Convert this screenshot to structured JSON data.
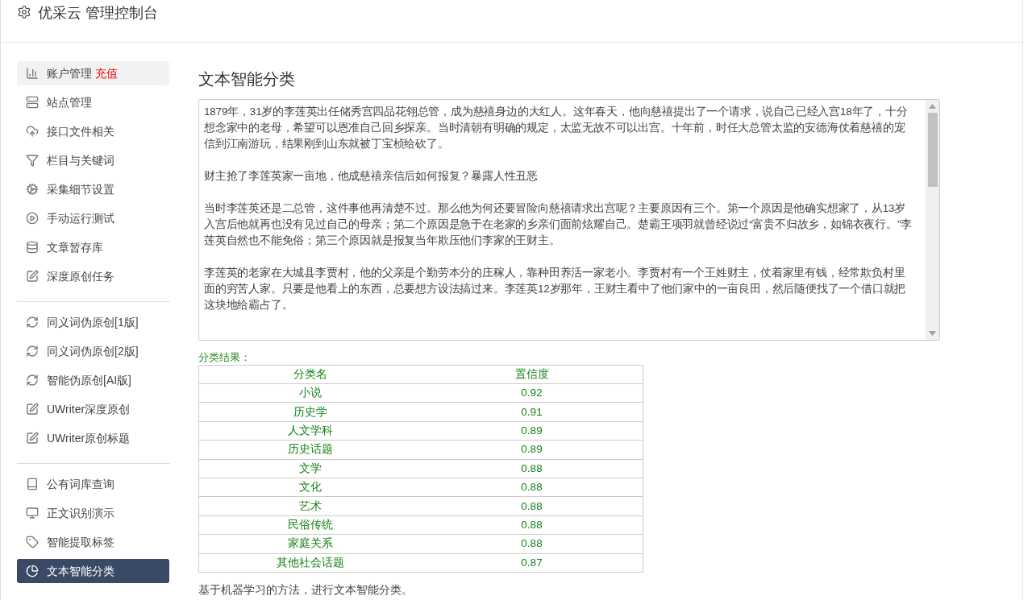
{
  "header": {
    "title": "优采云 管理控制台"
  },
  "sidebar": {
    "groups": [
      [
        {
          "label": "账户管理",
          "badge": "充值",
          "kind": "chart",
          "selected": false,
          "highlighted": true
        },
        {
          "label": "站点管理",
          "kind": "server",
          "selected": false,
          "highlighted": false
        },
        {
          "label": "接口文件相关",
          "kind": "cloud",
          "selected": false,
          "highlighted": false
        },
        {
          "label": "栏目与关键词",
          "kind": "filter",
          "selected": false,
          "highlighted": false
        },
        {
          "label": "采集细节设置",
          "kind": "cogs",
          "selected": false,
          "highlighted": false
        },
        {
          "label": "手动运行测试",
          "kind": "play",
          "selected": false,
          "highlighted": false
        },
        {
          "label": "文章暂存库",
          "kind": "database",
          "selected": false,
          "highlighted": false
        },
        {
          "label": "深度原创任务",
          "kind": "edit",
          "selected": false,
          "highlighted": false
        }
      ],
      [
        {
          "label": "同义词伪原创[1版]",
          "kind": "refresh",
          "selected": false,
          "highlighted": false
        },
        {
          "label": "同义词伪原创[2版]",
          "kind": "refresh",
          "selected": false,
          "highlighted": false
        },
        {
          "label": "智能伪原创[AI版]",
          "kind": "refresh",
          "selected": false,
          "highlighted": false
        },
        {
          "label": "UWriter深度原创",
          "kind": "edit",
          "selected": false,
          "highlighted": false
        },
        {
          "label": "UWriter原创标题",
          "kind": "edit",
          "selected": false,
          "highlighted": false
        }
      ],
      [
        {
          "label": "公有词库查询",
          "kind": "book",
          "selected": false,
          "highlighted": false
        },
        {
          "label": "正文识别演示",
          "kind": "monitor",
          "selected": false,
          "highlighted": false
        },
        {
          "label": "智能提取标签",
          "kind": "tag",
          "selected": false,
          "highlighted": false
        },
        {
          "label": "文本智能分类",
          "kind": "pie",
          "selected": true,
          "highlighted": false
        }
      ]
    ]
  },
  "main": {
    "title": "文本智能分类",
    "input": {
      "paragraphs": [
        "1879年，31岁的李莲英出任储秀宫四品花翎总管，成为慈禧身边的大红人。这年春天，他向慈禧提出了一个请求，说自己已经入宫18年了，十分想念家中的老母，希望可以恩准自己回乡探亲。当时清朝有明确的规定，太监无故不可以出宫。十年前，时任大总管太监的安德海仗着慈禧的宠信到江南游玩，结果刚到山东就被丁宝桢给砍了。",
        "财主抢了李莲英家一亩地，他成慈禧亲信后如何报复？暴露人性丑恶",
        "当时李莲英还是二总管，这件事他再清楚不过。那么他为何还要冒险向慈禧请求出宫呢？主要原因有三个。第一个原因是他确实想家了，从13岁入宫后他就再也没有见过自己的母亲；第二个原因是急于在老家的乡亲们面前炫耀自己。楚霸王项羽就曾经说过“富贵不归故乡，如锦衣夜行。”李莲英自然也不能免俗；第三个原因就是报复当年欺压他们李家的王财主。",
        "李莲英的老家在大城县李贾村，他的父亲是个勤劳本分的庄稼人，靠种田养活一家老小。李贾村有一个王姓财主，仗着家里有钱，经常欺负村里面的穷苦人家。只要是他看上的东西，总要想方设法搞过来。李莲英12岁那年，王财主看中了他们家中的一亩良田，然后随便找了一个借口就把这块地给霸占了。"
      ]
    },
    "result_label": "分类结果：",
    "table": {
      "columns": [
        "分类名",
        "置信度"
      ],
      "rows": [
        [
          "小说",
          "0.92"
        ],
        [
          "历史学",
          "0.91"
        ],
        [
          "人文学科",
          "0.89"
        ],
        [
          "历史话题",
          "0.89"
        ],
        [
          "文学",
          "0.88"
        ],
        [
          "文化",
          "0.88"
        ],
        [
          "艺术",
          "0.88"
        ],
        [
          "民俗传统",
          "0.88"
        ],
        [
          "家庭关系",
          "0.88"
        ],
        [
          "其他社会话题",
          "0.87"
        ]
      ]
    },
    "note": "基于机器学习的方法，进行文本智能分类。"
  }
}
